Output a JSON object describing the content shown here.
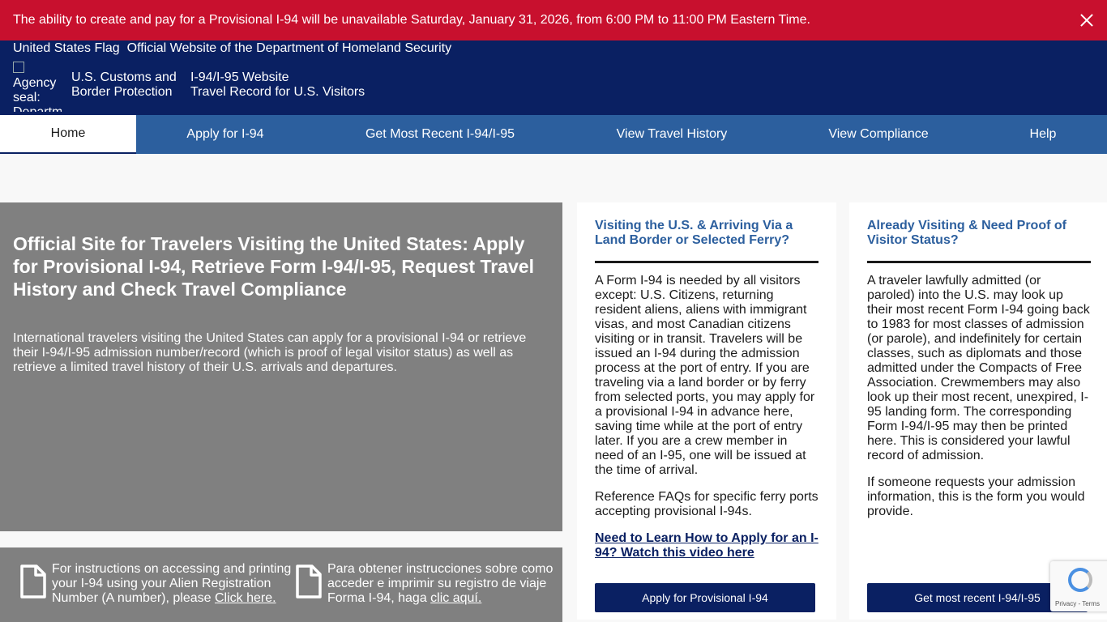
{
  "alert": {
    "message": "The ability to create and pay for a Provisional I-94 will be unavailable Saturday, January 31, 2026, from 6:00 PM to 11:00 PM Eastern Time."
  },
  "header": {
    "flag_alt": "United States Flag",
    "official_text": "Official Website of the Department of Homeland Security",
    "seal_alt": "Agency seal: Department",
    "agency_line1": "U.S. Customs and",
    "agency_line2": "Border Protection",
    "site_line1": "I-94/I-95 Website",
    "site_line2": "Travel Record for U.S. Visitors"
  },
  "nav": {
    "items": [
      {
        "label": "Home"
      },
      {
        "label": "Apply for I-94"
      },
      {
        "label": "Get Most Recent I-94/I-95"
      },
      {
        "label": "View Travel History"
      },
      {
        "label": "View Compliance"
      },
      {
        "label": "Help"
      }
    ]
  },
  "hero": {
    "title": "Official Site for Travelers Visiting the United States: Apply for Provisional I-94, Retrieve Form I-94/I-95, Request Travel History and Check Travel Compliance",
    "description": "International travelers visiting the United States can apply for a provisional I-94 or retrieve their I-94/I-95 admission number/record (which is proof of legal visitor status) as well as retrieve a limited travel history of their U.S. arrivals and departures."
  },
  "instructions": {
    "english_text": "For instructions on accessing and printing your I-94 using your Alien Registration Number (A number), please ",
    "english_link": "Click here.",
    "spanish_text": "Para obtener instrucciones sobre como acceder e imprimir su registro de viaje Forma I-94, haga ",
    "spanish_link": "clic aquí."
  },
  "cards": {
    "land": {
      "title": "Visiting the U.S. & Arriving Via a Land Border or Selected Ferry?",
      "body": "A Form I-94 is needed by all visitors except: U.S. Citizens, returning resident aliens, aliens with immigrant visas, and most Canadian citizens visiting or in transit. Travelers will be issued an I-94 during the admission process at the port of entry. If you are traveling via a land border or by ferry from selected ports, you may apply for a provisional I-94 in advance here, saving time while at the port of entry later. If you are a crew member in need of an I-95, one will be issued at the time of arrival.",
      "faq": "Reference FAQs for specific ferry ports accepting provisional I-94s.",
      "video_link": "Need to Learn How to Apply for an I-94? Watch this video here",
      "button": "Apply for Provisional I-94"
    },
    "proof": {
      "title": "Already Visiting & Need Proof of Visitor Status?",
      "body": "A traveler lawfully admitted (or paroled) into the U.S. may look up their most recent Form I-94 going back to 1983 for most classes of admission (or parole), and indefinitely for certain classes, such as diplomats and those admitted under the Compacts of Free Association. Crewmembers may also look up their most recent, unexpired, I-95 landing form. The corresponding Form I-94/I-95 may then be printed here. This is considered your lawful record of admission.",
      "extra": "If someone requests your admission information, this is the form you would provide.",
      "button": "Get most recent I-94/I-95"
    }
  },
  "recaptcha": {
    "terms": "Privacy - Terms"
  }
}
